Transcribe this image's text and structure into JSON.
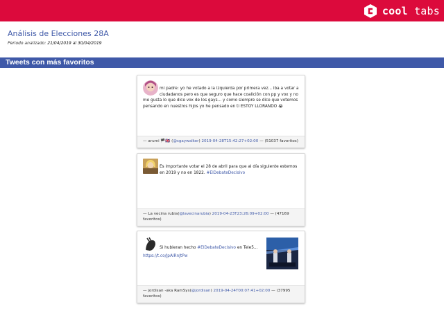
{
  "brand": {
    "name_bold": "cool",
    "name_light": " tabs"
  },
  "header": {
    "title": "Análisis de Elecciones 28A",
    "period_label": "Periodo analizado:",
    "period_value": "21/04/2019 al 30/04/2019"
  },
  "section": {
    "title": "Tweets con más favoritos"
  },
  "tweets": [
    {
      "text": "mi padre: yo he votado a la izquierda por primera vez... iba a votar a ciudadanos pero es que seguro que hace coalición con pp y vox y no me gusta lo que dice vox de los gays... y como siempre se dice que votemos pensando en nuestros hijos yo he pensado en ti ESTOY LLORANDO 😭",
      "author_prefix": "— arumi 🏴🇬🇧 (",
      "handle": "@sgaywalker",
      "author_suffix": ")",
      "date": "2019-04-28T15:42:27+02:00",
      "favorites": "— (51037 favoritos)"
    },
    {
      "text_before": "Es importante votar el 28 de abril para que al día siguiente estemos en 2019 y no en 1822.",
      "hashtag": "#ElDebateDecisivo",
      "author_prefix": "— La vecina rubia(",
      "handle": "@lavecinarubia",
      "author_suffix": ")",
      "date": "2019-04-23T23:26:09+02:00",
      "favorites": "— (47169 favoritos)"
    },
    {
      "text_before": "Si hubieran hecho",
      "hashtag": "#ElDebateDecisivo",
      "text_after": "en Tele5...",
      "url": "https://t.co/JpAlRnJtPw",
      "author_prefix": "— jordisan -aka RamSys(",
      "handle": "@jordisan",
      "author_suffix": ")",
      "date": "2019-04-24T00:07:41+02:00",
      "favorites": "— (37995 favoritos)"
    }
  ]
}
